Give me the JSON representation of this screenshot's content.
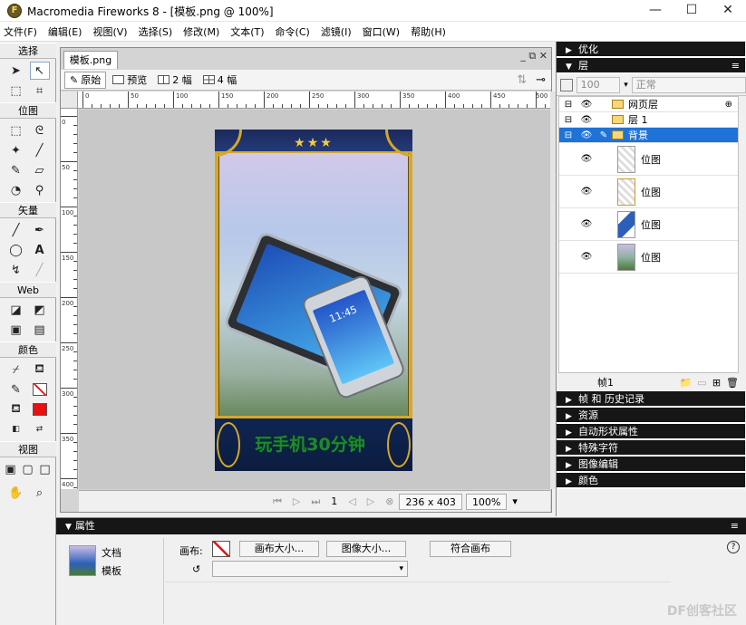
{
  "window": {
    "title": "Macromedia Fireworks 8 - [模板.png @ 100%]",
    "minimize": "—",
    "maximize": "☐",
    "close": "✕"
  },
  "menu": [
    "文件(F)",
    "编辑(E)",
    "视图(V)",
    "选择(S)",
    "修改(M)",
    "文本(T)",
    "命令(C)",
    "滤镜(I)",
    "窗口(W)",
    "帮助(H)"
  ],
  "tools": {
    "sections": {
      "select": "选择",
      "bitmap": "位图",
      "vector": "矢量",
      "web": "Web",
      "colors": "颜色",
      "view": "视图"
    }
  },
  "document": {
    "tab": "模板.png",
    "views": [
      "原始",
      "预览",
      "2 幅",
      "4 幅"
    ],
    "ruler_h": [
      "0",
      "50",
      "100",
      "150",
      "200",
      "250",
      "300",
      "350",
      "400",
      "450",
      "500"
    ],
    "ruler_v": [
      "0",
      "50",
      "100",
      "150",
      "200",
      "250",
      "300",
      "350",
      "400"
    ],
    "artwork": {
      "stars": "★★★",
      "banner_text": "玩手机30分钟",
      "phone_time": "11:45"
    },
    "status": {
      "frame": "1",
      "size": "236 x 403",
      "zoom": "100%"
    }
  },
  "panels": {
    "optimize": "优化",
    "layers": {
      "title": "层",
      "opacity": "100",
      "blend": "正常",
      "rows": [
        {
          "name": "网页层",
          "type": "folder"
        },
        {
          "name": "层 1",
          "type": "folder"
        },
        {
          "name": "背景",
          "type": "folder",
          "selected": true
        },
        {
          "name": "位图",
          "type": "bitmap"
        },
        {
          "name": "位图",
          "type": "bitmap"
        },
        {
          "name": "位图",
          "type": "bitmap"
        },
        {
          "name": "位图",
          "type": "bitmap"
        }
      ],
      "frame": "帧1"
    },
    "collapsed": [
      "帧 和 历史记录",
      "资源",
      "自动形状属性",
      "特殊字符",
      "图像编辑",
      "颜色"
    ]
  },
  "properties": {
    "title": "属性",
    "doc_label": "文档",
    "doc_name": "模板",
    "canvas_label": "画布:",
    "buttons": [
      "画布大小...",
      "图像大小...",
      "符合画布"
    ],
    "help": "?"
  },
  "watermark": "DF创客社区",
  "colors": {
    "accent": "#1f73d8",
    "panel_header": "#161616",
    "frame_gold": "#d4a82a",
    "fill": "#e81010"
  }
}
